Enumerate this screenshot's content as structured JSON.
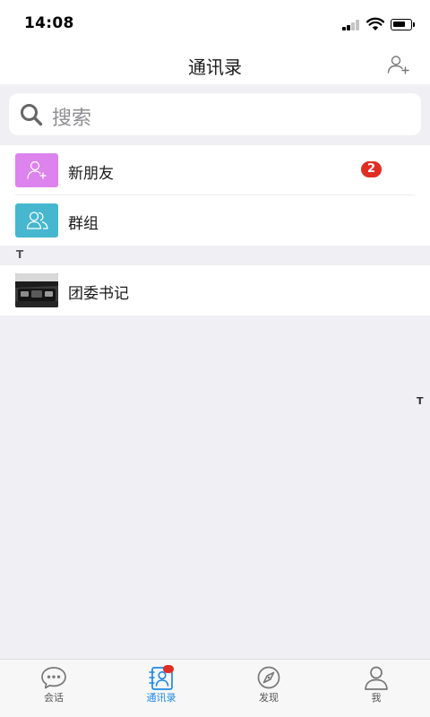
{
  "status_bar": {
    "time": "14:08"
  },
  "nav": {
    "title": "通讯录",
    "add_contact_icon": "person-add-icon"
  },
  "search": {
    "placeholder": "搜索",
    "icon": "search-icon"
  },
  "list": {
    "new_friends": {
      "label": "新朋友",
      "badge": "2",
      "icon": "person-add-icon",
      "color": "#dc83ee"
    },
    "groups": {
      "label": "群组",
      "icon": "people-icon",
      "color": "#47b7cf"
    },
    "sections": [
      {
        "letter": "T",
        "contacts": [
          {
            "name": "团委书记"
          }
        ]
      }
    ]
  },
  "index_bar": [
    "T"
  ],
  "tabs": [
    {
      "label": "会话",
      "icon": "chat-bubble-icon",
      "active": false
    },
    {
      "label": "通讯录",
      "icon": "contacts-icon",
      "active": true
    },
    {
      "label": "发现",
      "icon": "compass-icon",
      "active": false
    },
    {
      "label": "我",
      "icon": "user-icon",
      "active": false
    }
  ],
  "colors": {
    "accent": "#1e88e5",
    "badge": "#e02e24",
    "background": "#efeff4"
  }
}
